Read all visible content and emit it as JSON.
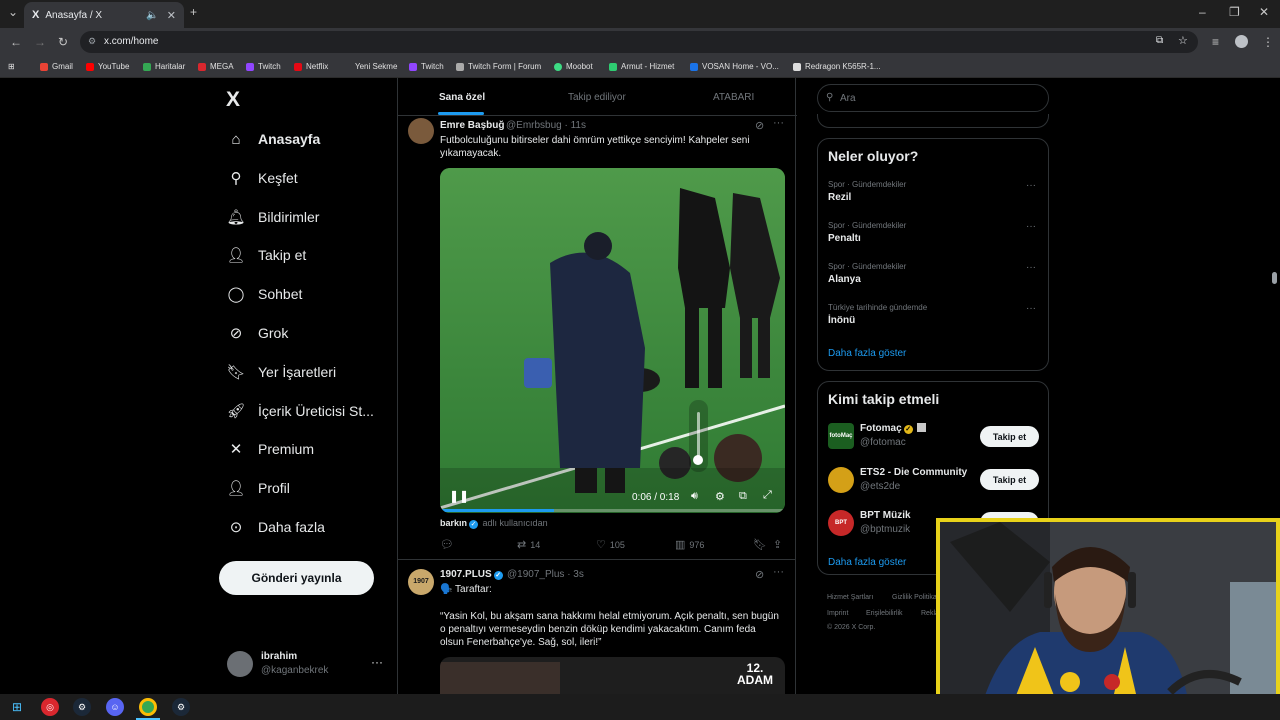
{
  "browser": {
    "tab_title": "Anasayfa / X",
    "tab_favicon": "X",
    "url": "x.com/home",
    "bookmarks": [
      "Gmail",
      "YouTube",
      "Haritalar",
      "MEGA",
      "Twitch",
      "Netflix",
      "Yeni Sekme",
      "Twitch",
      "Twitch Form | Forum",
      "Moobot",
      "Armut - Hizmet",
      "VOSAN Home - VO...",
      "Redragon K565R-1..."
    ],
    "bookmark_colors": [
      "#ea4335",
      "#ff0000",
      "#34a853",
      "#d9272e",
      "#9146ff",
      "#e50914",
      "#8ab4f8",
      "#9146ff",
      "#aaaaaa",
      "#3ddc84",
      "#2ecc71",
      "#1a73e8",
      "#dddddd"
    ]
  },
  "nav": {
    "logo": "X",
    "items": [
      {
        "label": "Anasayfa",
        "icon": "home-icon"
      },
      {
        "label": "Keşfet",
        "icon": "search-icon"
      },
      {
        "label": "Bildirimler",
        "icon": "bell-icon"
      },
      {
        "label": "Takip et",
        "icon": "add-user-icon"
      },
      {
        "label": "Sohbet",
        "icon": "chat-icon"
      },
      {
        "label": "Grok",
        "icon": "grok-icon"
      },
      {
        "label": "Yer İşaretleri",
        "icon": "bookmark-icon"
      },
      {
        "label": "İçerik Üreticisi St...",
        "icon": "rocket-icon"
      },
      {
        "label": "Premium",
        "icon": "x-premium-icon"
      },
      {
        "label": "Profil",
        "icon": "profile-icon"
      },
      {
        "label": "Daha fazla",
        "icon": "more-circle-icon"
      }
    ],
    "post_button": "Gönderi yayınla",
    "account": {
      "name": "ibrahim",
      "handle": "@kaganbekrek"
    }
  },
  "feed": {
    "tabs": [
      "Sana özel",
      "Takip ediliyor",
      "ATABARI"
    ],
    "tweets": [
      {
        "name": "Emre Başbuğ",
        "handle": "@Emrbsbug · 11s",
        "text": "Futbolculuğunu bitirseler dahi ömrüm yettikçe senciyim! Kahpeler seni yıkamayacak.",
        "video": {
          "time": "0:06 / 0:18",
          "progress": 0.33
        },
        "credit_name": "barkın",
        "credit_suffix": "adlı kullanıcıdan",
        "retweets": "14",
        "likes": "105",
        "views": "976"
      },
      {
        "name": "1907.PLUS",
        "handle": "@1907_Plus · 3s",
        "text_line1": "🗣️ Taraftar:",
        "text": "“Yasin Kol, bu akşam sana hakkımı helal etmiyorum. Açık penaltı, sen bugün o penaltıyı vermeseydin benzin döküp kendimi yakacaktım. Canım feda olsun Fenerbahçe'ye. Sağ, sol, ileri!”",
        "media_label_1": "12.",
        "media_label_2": "ADAM"
      }
    ]
  },
  "sidebar": {
    "search_placeholder": "Ara",
    "trends_title": "Neler oluyor?",
    "trends": [
      {
        "category": "Spor · Gündemdekiler",
        "name": "Rezil"
      },
      {
        "category": "Spor · Gündemdekiler",
        "name": "Penaltı"
      },
      {
        "category": "Spor · Gündemdekiler",
        "name": "Alanya"
      },
      {
        "category": "Türkiye tarihinde gündemde",
        "name": "İnönü"
      }
    ],
    "show_more": "Daha fazla göster",
    "who_title": "Kimi takip etmeli",
    "who": [
      {
        "name": "Fotomaç",
        "handle": "@fotomac",
        "avatar_text": "fotoMaç",
        "button": "Takip et"
      },
      {
        "name": "ETS2 - Die Community",
        "handle": "@ets2de",
        "avatar_text": "",
        "button": "Takip et"
      },
      {
        "name": "BPT Müzik",
        "handle": "@bptmuzik",
        "avatar_text": "BPT",
        "button": "Takip et"
      }
    ],
    "who_show_more": "Daha fazla göster",
    "footer": [
      "Hizmet Şartları",
      "Gizlilik Politikası",
      "Imprint",
      "Erişilebilirlik",
      "Reklam",
      "© 2026 X Corp."
    ]
  }
}
